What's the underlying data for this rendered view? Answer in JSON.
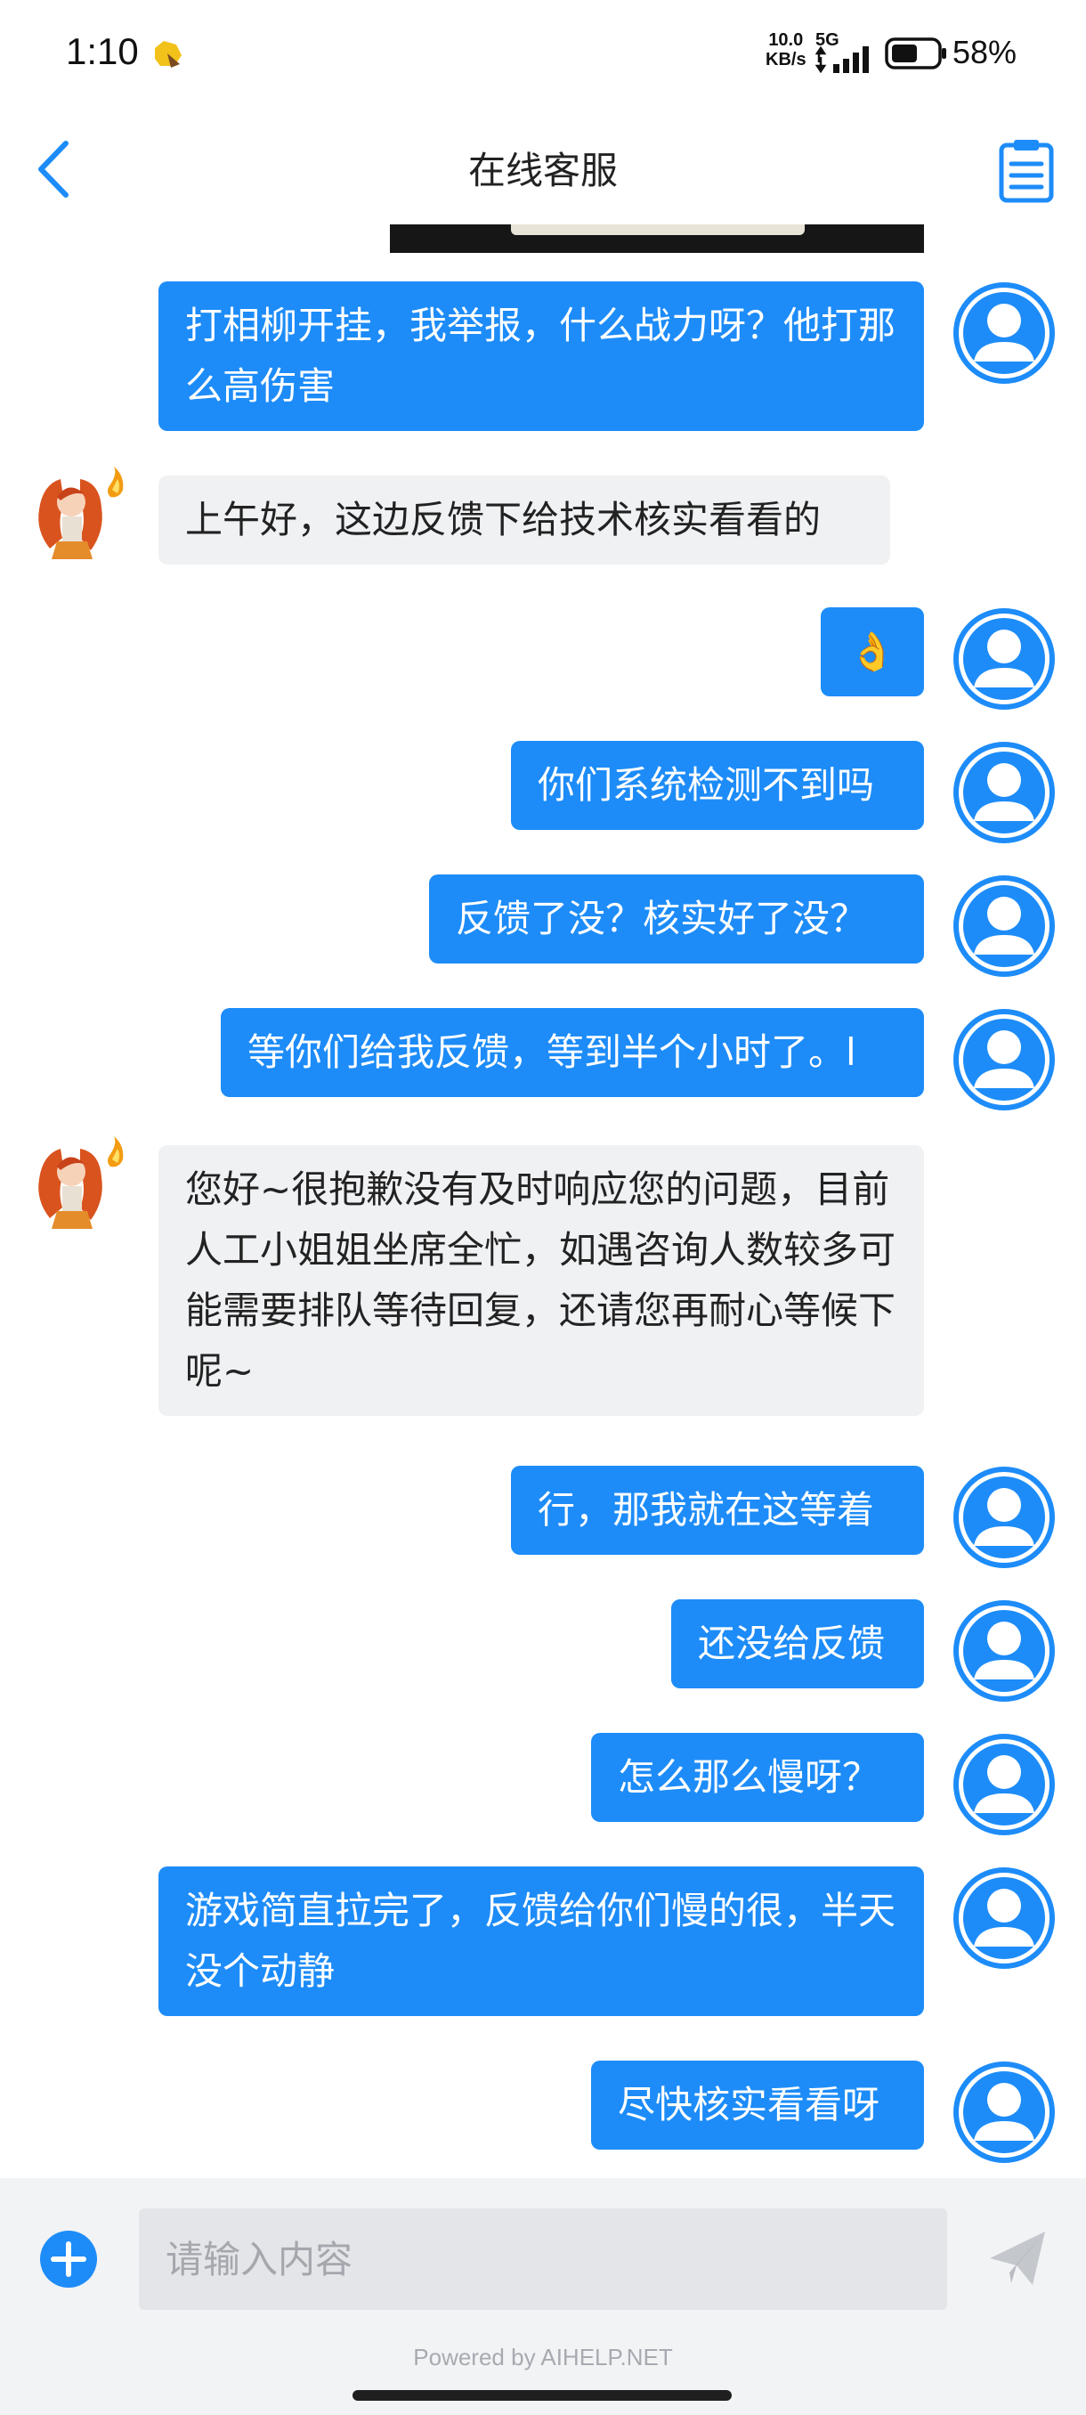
{
  "status_bar": {
    "time": "1:10",
    "net_speed_value": "10.0",
    "net_speed_unit": "KB/s",
    "network": "5G",
    "battery_percent": "58%",
    "battery_level": 0.58
  },
  "header": {
    "title": "在线客服"
  },
  "messages": [
    {
      "from": "user",
      "text": "打相柳开挂，我举报，什么战力呀？他打那么高伤害"
    },
    {
      "from": "agent",
      "text": "上午好，这边反馈下给技术核实看看的"
    },
    {
      "from": "user",
      "text": "👌"
    },
    {
      "from": "user",
      "text": "你们系统检测不到吗"
    },
    {
      "from": "user",
      "text": "反馈了没？核实好了没？"
    },
    {
      "from": "user",
      "text": "等你们给我反馈，等到半个小时了。l"
    },
    {
      "from": "agent",
      "text": "您好~很抱歉没有及时响应您的问题，目前人工小姐姐坐席全忙，如遇咨询人数较多可能需要排队等待回复，还请您再耐心等候下呢~"
    },
    {
      "from": "user",
      "text": "行，那我就在这等着"
    },
    {
      "from": "user",
      "text": "还没给反馈"
    },
    {
      "from": "user",
      "text": "怎么那么慢呀？"
    },
    {
      "from": "user",
      "text": "游戏简直拉完了，反馈给你们慢的很，半天没个动静"
    },
    {
      "from": "user",
      "text": "尽快核实看看呀"
    }
  ],
  "composer": {
    "placeholder": "请输入内容",
    "value": ""
  },
  "footer": {
    "powered_by": "Powered by AIHELP.NET"
  },
  "icons": {
    "back": "chevron-left-icon",
    "notes": "clipboard-list-icon",
    "add": "plus-circle-icon",
    "send": "paper-plane-icon",
    "user_avatar": "user-avatar-icon",
    "agent_avatar": "agent-avatar"
  },
  "colors": {
    "accent": "#1d8cf8",
    "outgoing_bubble": "#1d8cf8",
    "incoming_bubble": "#f0f1f3",
    "composer_bg": "#f2f3f5"
  }
}
